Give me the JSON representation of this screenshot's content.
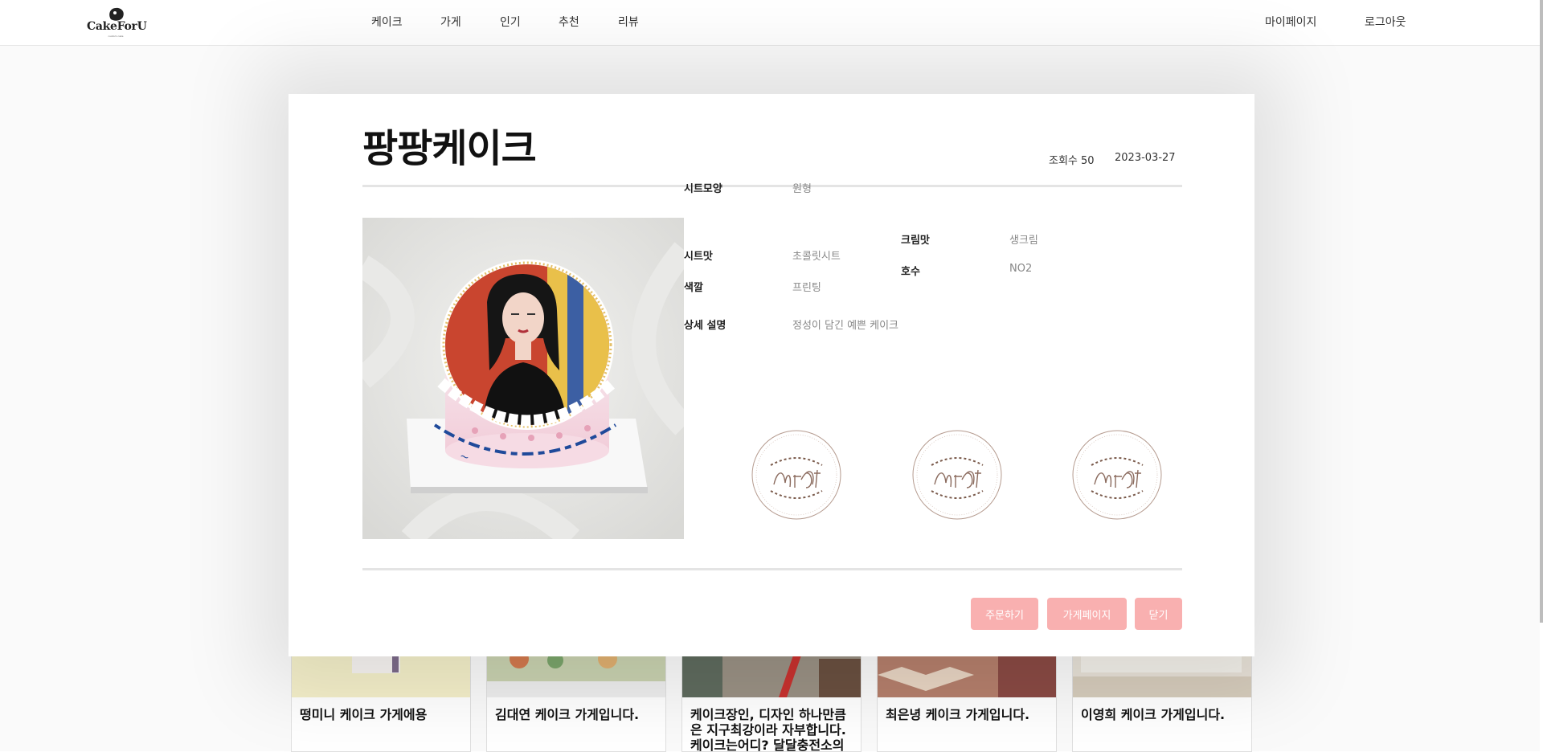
{
  "header": {
    "logo_text": "CakeForU",
    "logo_tag": "custom cake",
    "nav": [
      "케이크",
      "가게",
      "인기",
      "추천",
      "리뷰"
    ],
    "mypage": "마이페이지",
    "logout": "로그아웃"
  },
  "modal": {
    "title": "팡팡케이크",
    "views": "조회수 50",
    "date": "2023-03-27",
    "specs": {
      "sheet_shape_label": "시트모양",
      "sheet_shape_value": "원형",
      "sheet_flavor_label": "시트맛",
      "sheet_flavor_value": "초콜릿시트",
      "color_label": "색깔",
      "color_value": "프린팅",
      "cream_label": "크림맛",
      "cream_value": "생크림",
      "size_label": "호수",
      "size_value": "NO2",
      "desc_label": "상세 설명",
      "desc_value": "정성이 담긴 예쁜 케이크"
    },
    "stamp_icons": [
      "cakeforu-stamp-icon",
      "cakeforu-stamp-icon",
      "cakeforu-stamp-icon"
    ],
    "buttons": {
      "order": "주문하기",
      "store": "가게페이지",
      "close": "닫기"
    }
  },
  "background_cards": [
    {
      "title": "떵미니 케이크 가게에용"
    },
    {
      "title": "김대연 케이크 가게입니다."
    },
    {
      "title": "케이크장인, 디자인 하나만큼은 지구최강이라 자부합니다. 케이크는어디? 달달충전소의"
    },
    {
      "title": "최은녕 케이크 가게입니다."
    },
    {
      "title": "이영희 케이크 가게입니다."
    }
  ],
  "colors": {
    "button_bg": "#f9b0b0",
    "rule": "#e4e4e4",
    "stamp_brown": "#9c7a6a"
  }
}
